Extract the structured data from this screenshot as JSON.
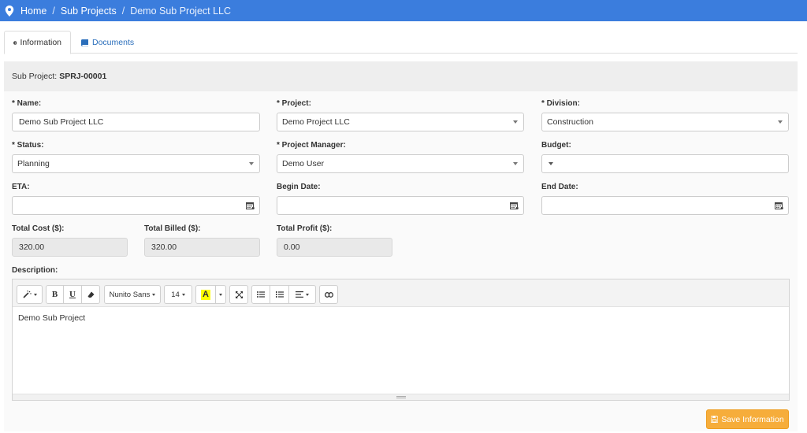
{
  "colors": {
    "topbar": "#3b7ddd",
    "save_button": "#f6ad3b",
    "link": "#2a6ebb"
  },
  "breadcrumb": {
    "items": [
      "Home",
      "Sub Projects",
      "Demo Sub Project LLC"
    ],
    "separator": "/"
  },
  "tabs": [
    {
      "label": "Information",
      "icon": "info-circle-icon",
      "active": true
    },
    {
      "label": "Documents",
      "icon": "book-icon",
      "active": false
    }
  ],
  "subproject": {
    "label": "Sub Project:",
    "code": "SPRJ-00001"
  },
  "form": {
    "name": {
      "label": "* Name:",
      "value": "Demo Sub Project LLC"
    },
    "project": {
      "label": "* Project:",
      "value": "Demo Project LLC"
    },
    "division": {
      "label": "* Division:",
      "value": "Construction"
    },
    "status": {
      "label": "* Status:",
      "value": "Planning"
    },
    "project_manager": {
      "label": "* Project Manager:",
      "value": "Demo User"
    },
    "budget": {
      "label": "Budget:",
      "value": ""
    },
    "eta": {
      "label": "ETA:",
      "value": ""
    },
    "begin_date": {
      "label": "Begin Date:",
      "value": ""
    },
    "end_date": {
      "label": "End Date:",
      "value": ""
    },
    "total_cost": {
      "label": "Total Cost ($):",
      "value": "320.00"
    },
    "total_billed": {
      "label": "Total Billed ($):",
      "value": "320.00"
    },
    "total_profit": {
      "label": "Total Profit ($):",
      "value": "0.00"
    },
    "description": {
      "label": "Description:",
      "value": "Demo Sub Project"
    }
  },
  "editor_toolbar": {
    "font_family": "Nunito Sans",
    "font_size": "14",
    "bold": "B",
    "underline": "U",
    "highlight": "A"
  },
  "save_button": {
    "label": "Save Information",
    "icon": "floppy-disk-icon"
  }
}
